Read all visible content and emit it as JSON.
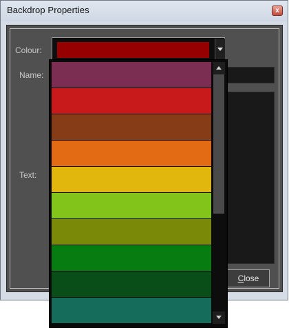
{
  "window": {
    "title": "Backdrop Properties",
    "close_glyph": "x"
  },
  "form": {
    "colour_label": "Colour:",
    "name_label": "Name:",
    "text_label": "Text:",
    "selected_colour": "#960000",
    "close_button_prefix": "",
    "close_button_mnemonic": "C",
    "close_button_rest": "lose"
  },
  "colour_options": [
    "#7b2d52",
    "#c8191b",
    "#863c16",
    "#e26b14",
    "#e2b70d",
    "#82c41a",
    "#7a8a08",
    "#077d11",
    "#094d19",
    "#156c5a"
  ],
  "icons": {
    "dropdown": "chevron-down-icon",
    "scroll_up": "chevron-up-icon",
    "scroll_down": "chevron-down-icon",
    "close": "close-icon"
  },
  "scrollbar": {
    "position_fraction": 0.0
  }
}
